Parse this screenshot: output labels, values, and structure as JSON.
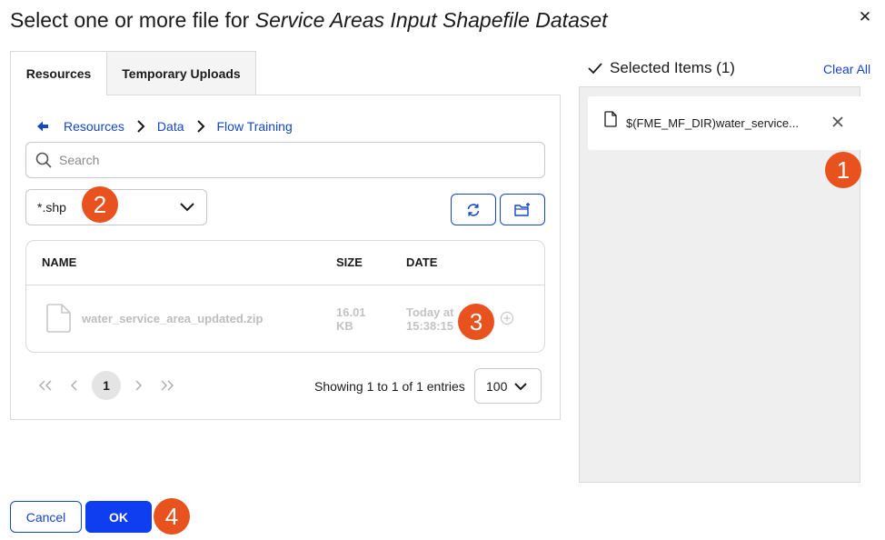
{
  "dialog": {
    "title_prefix": "Select one or more file for ",
    "title_dataset": "Service Areas Input Shapefile Dataset",
    "close_label": "✕"
  },
  "tabs": [
    {
      "label": "Resources",
      "active": true
    },
    {
      "label": "Temporary Uploads",
      "active": false
    }
  ],
  "breadcrumb": [
    "Resources",
    "Data",
    "Flow Training"
  ],
  "search": {
    "placeholder": "Search",
    "value": ""
  },
  "filter": {
    "value": "*.shp"
  },
  "table": {
    "headers": {
      "name": "NAME",
      "size": "SIZE",
      "date": "DATE"
    },
    "rows": [
      {
        "name": "water_service_area_updated.zip",
        "size_line1": "16.01",
        "size_line2": "KB",
        "date_line1": "Today at",
        "date_line2": "15:38:15"
      }
    ]
  },
  "pagination": {
    "current_page": "1",
    "showing": "Showing 1 to 1 of 1 entries",
    "per_page": "100"
  },
  "selected": {
    "heading": "Selected Items (1)",
    "clear_all": "Clear All",
    "items": [
      "$(FME_MF_DIR)water_service..."
    ]
  },
  "footer": {
    "cancel_label": "Cancel",
    "ok_label": "OK"
  },
  "callouts": [
    "1",
    "2",
    "3",
    "4"
  ],
  "colors": {
    "accent": "#1546c8",
    "primary_button": "#0f3ef0",
    "callout": "#e8521e",
    "selected_panel_bg": "#efefef"
  }
}
